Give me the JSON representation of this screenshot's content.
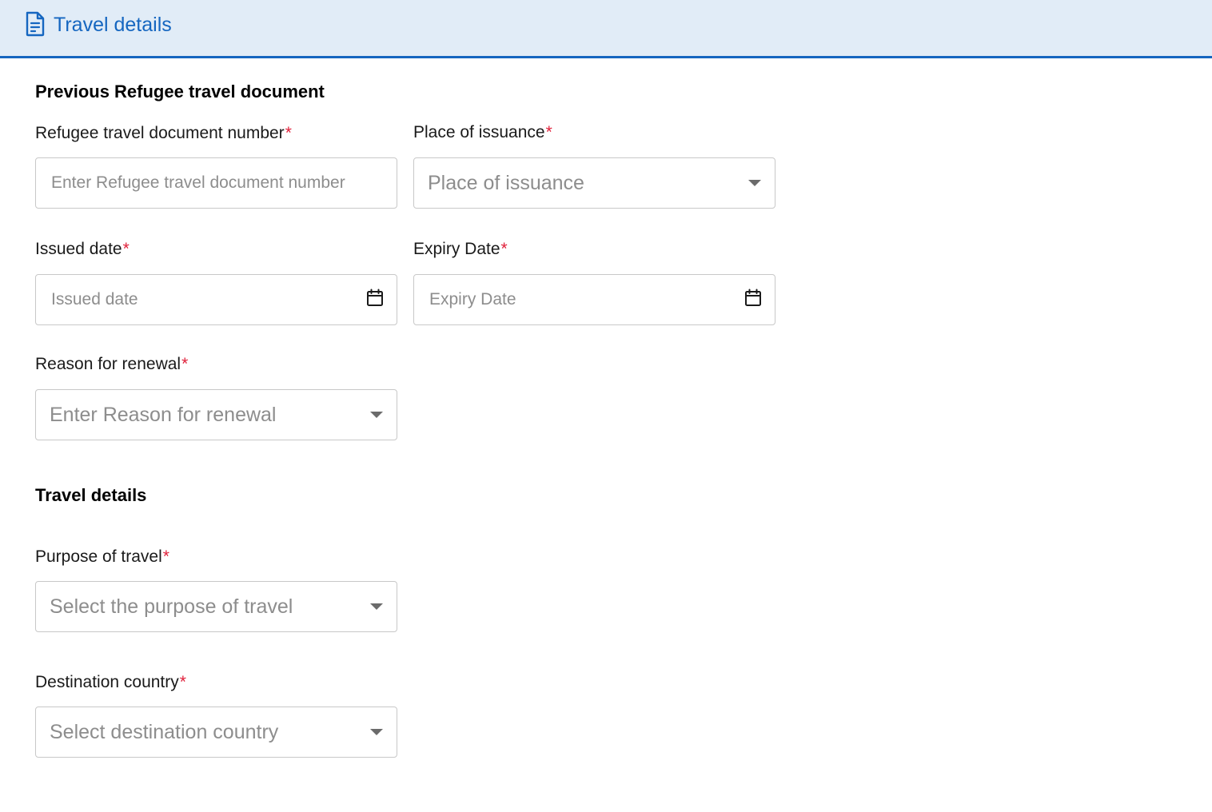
{
  "header": {
    "title": "Travel details",
    "accent_color": "#1566c0",
    "background_color": "#e1ecf7",
    "icon": "document-icon"
  },
  "section_previous": {
    "title": "Previous Refugee travel document",
    "doc_number": {
      "label": "Refugee travel document number",
      "required_mark": "*",
      "placeholder": "Enter Refugee travel document number",
      "value": ""
    },
    "place_of_issuance": {
      "label": "Place of issuance",
      "required_mark": "*",
      "selected_text": "Place of issuance",
      "icon": "chevron-down-icon"
    },
    "issued_date": {
      "label": "Issued date",
      "required_mark": "*",
      "placeholder": "Issued date",
      "value": "",
      "icon": "calendar-icon"
    },
    "expiry_date": {
      "label": "Expiry Date",
      "required_mark": "*",
      "placeholder": "Expiry Date",
      "value": "",
      "icon": "calendar-icon"
    },
    "reason_for_renewal": {
      "label": "Reason for renewal",
      "required_mark": "*",
      "selected_text": "Enter Reason for renewal",
      "icon": "chevron-down-icon"
    }
  },
  "section_travel": {
    "title": "Travel details",
    "purpose_of_travel": {
      "label": "Purpose of travel",
      "required_mark": "*",
      "selected_text": "Select the purpose of travel",
      "icon": "chevron-down-icon"
    },
    "destination_country": {
      "label": "Destination country",
      "required_mark": "*",
      "selected_text": "Select destination country",
      "icon": "chevron-down-icon"
    }
  },
  "colors": {
    "required": "#e0203a",
    "placeholder": "#8d8d8d",
    "border": "#c8c8c8"
  }
}
